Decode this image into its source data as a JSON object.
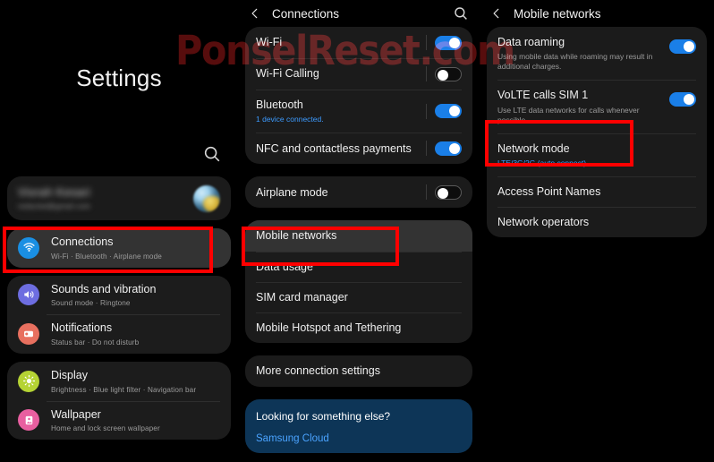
{
  "watermark": {
    "text": "PonselReset.com",
    "color": "#5c0d0d"
  },
  "settings_panel": {
    "title": "Settings",
    "search_icon": "search-icon",
    "account": {
      "name": "Viorah Kesari",
      "email": "redacted@gmail.com"
    },
    "groups": [
      {
        "items": [
          {
            "title": "Connections",
            "subtitle": "Wi-Fi  ·  Bluetooth  ·  Airplane mode",
            "icon": "wifi-icon",
            "icon_color": "#1a8fe3",
            "highlighted": true
          }
        ]
      },
      {
        "items": [
          {
            "title": "Sounds and vibration",
            "subtitle": "Sound mode  ·  Ringtone",
            "icon": "speaker-icon",
            "icon_color": "#6d6de0",
            "highlighted": false
          },
          {
            "title": "Notifications",
            "subtitle": "Status bar  ·  Do not disturb",
            "icon": "notification-icon",
            "icon_color": "#e8705f",
            "highlighted": false
          }
        ]
      },
      {
        "items": [
          {
            "title": "Display",
            "subtitle": "Brightness  ·  Blue light filter  ·  Navigation bar",
            "icon": "brightness-icon",
            "icon_color": "#b5d334",
            "highlighted": false
          },
          {
            "title": "Wallpaper",
            "subtitle": "Home and lock screen wallpaper",
            "icon": "wallpaper-icon",
            "icon_color": "#e85fa0",
            "highlighted": false
          }
        ]
      }
    ]
  },
  "connections_panel": {
    "title": "Connections",
    "back_icon": "back-chevron-icon",
    "search_icon": "search-icon",
    "cards": [
      {
        "rows": [
          {
            "title": "Wi-Fi",
            "subtitle": "",
            "toggle": "on",
            "highlighted": false
          },
          {
            "title": "Wi-Fi Calling",
            "subtitle": "",
            "toggle": "off",
            "highlighted": false
          },
          {
            "title": "Bluetooth",
            "subtitle": "1 device connected.",
            "subtitle_style": "blue",
            "toggle": "on",
            "highlighted": false
          },
          {
            "title": "NFC and contactless payments",
            "subtitle": "",
            "toggle": "on",
            "highlighted": false
          }
        ]
      },
      {
        "rows": [
          {
            "title": "Airplane mode",
            "subtitle": "",
            "toggle": "off",
            "highlighted": false
          }
        ]
      },
      {
        "rows": [
          {
            "title": "Mobile networks",
            "subtitle": "",
            "toggle": "none",
            "highlighted": true
          },
          {
            "title": "Data usage",
            "subtitle": "",
            "toggle": "none",
            "highlighted": false
          },
          {
            "title": "SIM card manager",
            "subtitle": "",
            "toggle": "none",
            "highlighted": false
          },
          {
            "title": "Mobile Hotspot and Tethering",
            "subtitle": "",
            "toggle": "none",
            "highlighted": false
          }
        ]
      },
      {
        "rows": [
          {
            "title": "More connection settings",
            "subtitle": "",
            "toggle": "none",
            "highlighted": false
          }
        ]
      }
    ],
    "promo": {
      "title": "Looking for something else?",
      "link": "Samsung Cloud"
    }
  },
  "mobile_networks_panel": {
    "title": "Mobile networks",
    "back_icon": "back-chevron-icon",
    "rows": [
      {
        "title": "Data roaming",
        "subtitle": "Using mobile data while roaming may result in additional charges.",
        "toggle": "on",
        "highlighted": false
      },
      {
        "title": "VoLTE calls SIM 1",
        "subtitle": "Use LTE data networks for calls whenever possible.",
        "toggle": "on",
        "highlighted": false
      },
      {
        "title": "Network mode",
        "subtitle": "LTE/3G/2G (auto connect)",
        "subtitle_style": "blue",
        "toggle": "none",
        "highlighted": false
      },
      {
        "title": "Access Point Names",
        "subtitle": "",
        "toggle": "none",
        "highlighted": false
      },
      {
        "title": "Network operators",
        "subtitle": "",
        "toggle": "none",
        "highlighted": false
      }
    ]
  },
  "annotations": {
    "connections_box": "red-highlight-connections",
    "mobile_networks_box": "red-highlight-mobile-networks",
    "network_mode_box": "red-highlight-network-mode"
  }
}
